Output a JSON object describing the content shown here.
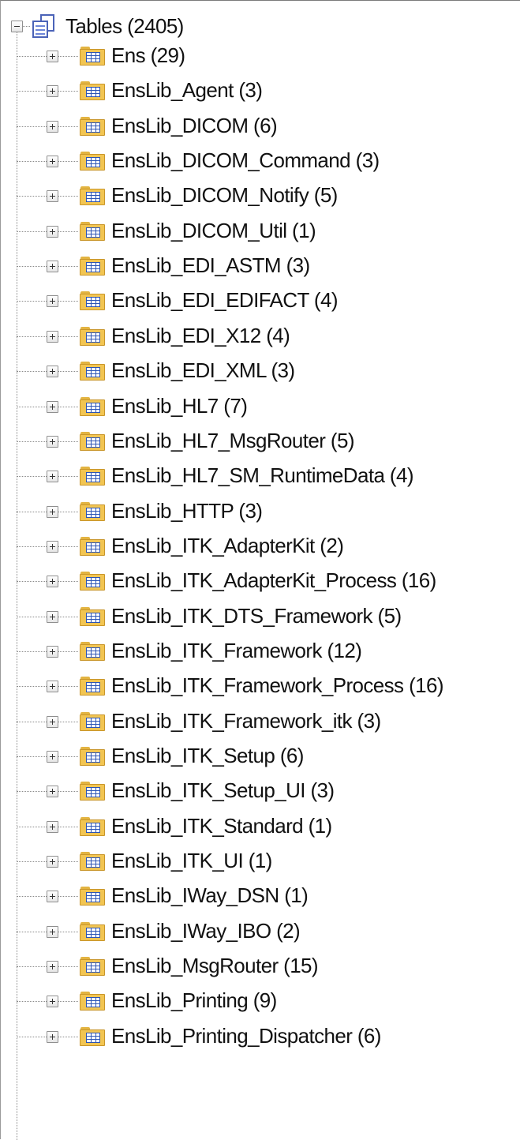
{
  "tree": {
    "root": {
      "label": "Tables (2405)",
      "expanded": true,
      "icon": "tables-icon"
    },
    "items": [
      {
        "label": "Ens (29)"
      },
      {
        "label": "EnsLib_Agent (3)"
      },
      {
        "label": "EnsLib_DICOM (6)"
      },
      {
        "label": "EnsLib_DICOM_Command (3)"
      },
      {
        "label": "EnsLib_DICOM_Notify (5)"
      },
      {
        "label": "EnsLib_DICOM_Util (1)"
      },
      {
        "label": "EnsLib_EDI_ASTM (3)"
      },
      {
        "label": "EnsLib_EDI_EDIFACT (4)"
      },
      {
        "label": "EnsLib_EDI_X12 (4)"
      },
      {
        "label": "EnsLib_EDI_XML (3)"
      },
      {
        "label": "EnsLib_HL7 (7)"
      },
      {
        "label": "EnsLib_HL7_MsgRouter (5)"
      },
      {
        "label": "EnsLib_HL7_SM_RuntimeData (4)"
      },
      {
        "label": "EnsLib_HTTP (3)"
      },
      {
        "label": "EnsLib_ITK_AdapterKit (2)"
      },
      {
        "label": "EnsLib_ITK_AdapterKit_Process (16)"
      },
      {
        "label": "EnsLib_ITK_DTS_Framework (5)"
      },
      {
        "label": "EnsLib_ITK_Framework (12)"
      },
      {
        "label": "EnsLib_ITK_Framework_Process (16)"
      },
      {
        "label": "EnsLib_ITK_Framework_itk (3)"
      },
      {
        "label": "EnsLib_ITK_Setup (6)"
      },
      {
        "label": "EnsLib_ITK_Setup_UI (3)"
      },
      {
        "label": "EnsLib_ITK_Standard (1)"
      },
      {
        "label": "EnsLib_ITK_UI (1)"
      },
      {
        "label": "EnsLib_IWay_DSN (1)"
      },
      {
        "label": "EnsLib_IWay_IBO (2)"
      },
      {
        "label": "EnsLib_MsgRouter (15)"
      },
      {
        "label": "EnsLib_Printing (9)"
      },
      {
        "label": "EnsLib_Printing_Dispatcher (6)"
      }
    ]
  },
  "colors": {
    "folder": "#f2c552",
    "table_grid": "#2d55b5",
    "connector": "#8a8a8a"
  }
}
